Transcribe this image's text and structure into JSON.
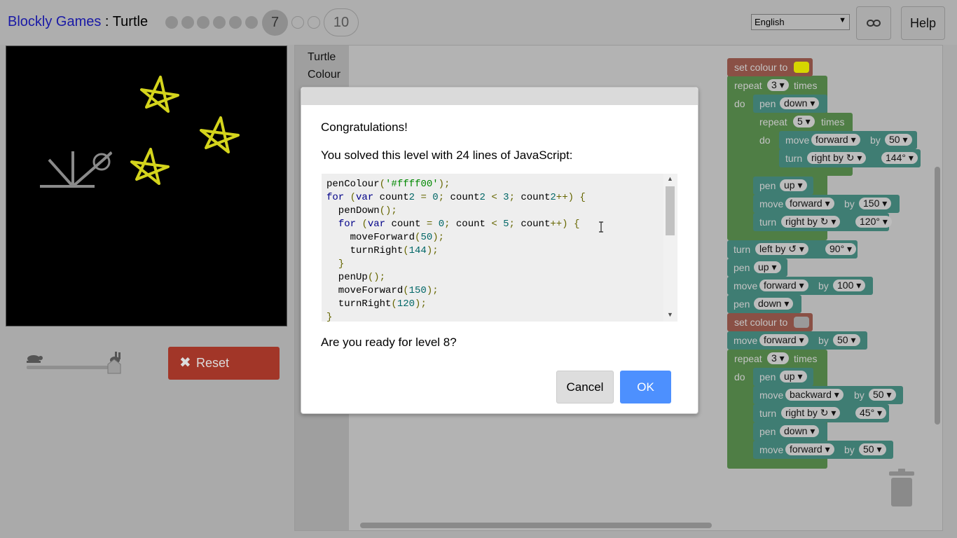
{
  "header": {
    "app_name": "Blockly Games",
    "separator": " : ",
    "game_name": "Turtle",
    "current_level": "7",
    "last_level": "10",
    "language": "English",
    "help_label": "Help"
  },
  "controls": {
    "reset_label": "Reset"
  },
  "toolbox": {
    "categories": [
      "Turtle",
      "Colour"
    ]
  },
  "blocks": {
    "set_colour": "set colour to",
    "repeat": "repeat",
    "times": "times",
    "do": "do",
    "pen": "pen",
    "move": "move",
    "turn": "turn",
    "by": "by",
    "down": "down",
    "up": "up",
    "forward": "forward",
    "backward": "backward",
    "right_by": "right by ↻",
    "left_by": "left by ↺",
    "n3": "3",
    "n5": "5",
    "n50": "50",
    "n100": "100",
    "n150": "150",
    "a144": "144°",
    "a120": "120°",
    "a90": "90°",
    "a45": "45°",
    "colour_yellow": "#d6d600",
    "colour_grey": "#9a9a9a"
  },
  "dialog": {
    "title": "Congratulations!",
    "summary": "You solved this level with 24 lines of JavaScript:",
    "question": "Are you ready for level 8?",
    "cancel_label": "Cancel",
    "ok_label": "OK",
    "code_lines": [
      "penColour('#ffff00');",
      "for (var count2 = 0; count2 < 3; count2++) {",
      "  penDown();",
      "  for (var count = 0; count < 5; count++) {",
      "    moveForward(50);",
      "    turnRight(144);",
      "  }",
      "  penUp();",
      "  moveForward(150);",
      "  turnRight(120);",
      "}"
    ]
  },
  "colors": {
    "star": "#d4d41c",
    "turtle": "#8a8a8a",
    "reset": "#a23628",
    "ok": "#4d90fe",
    "block_green": "#4f7e45",
    "block_teal": "#3f7d73",
    "block_brown": "#8a5045"
  }
}
